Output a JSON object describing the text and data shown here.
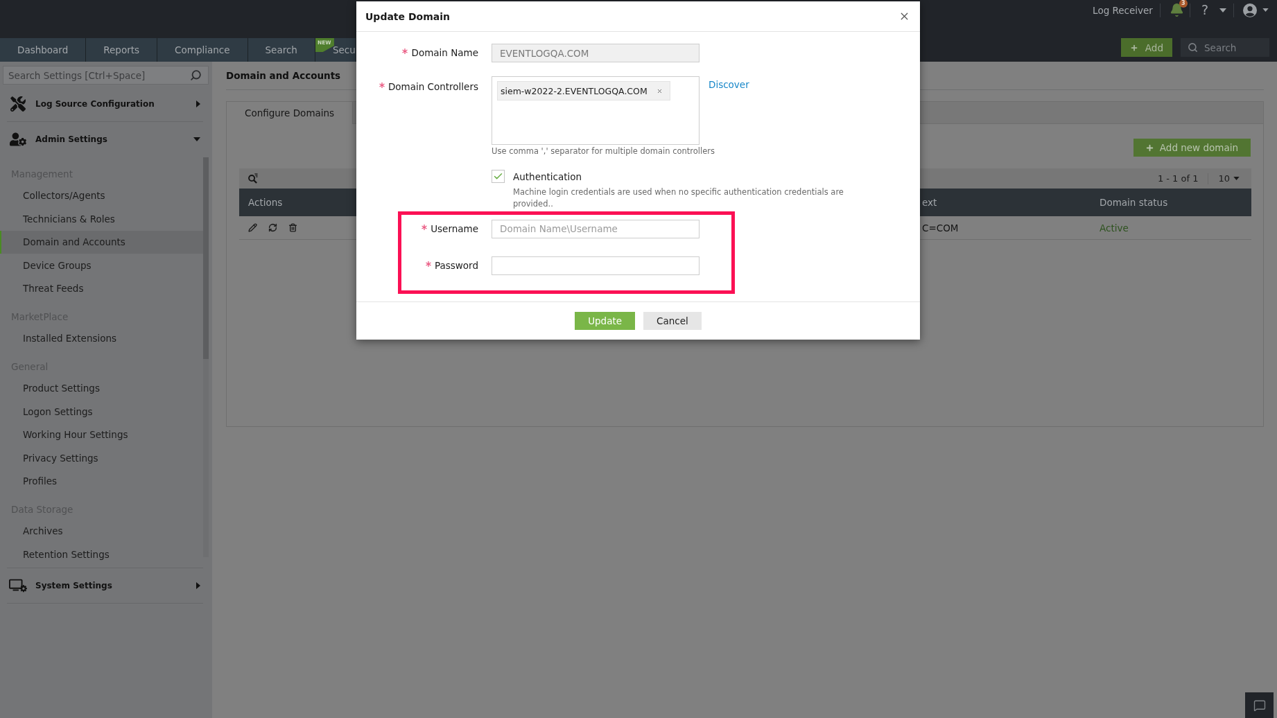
{
  "top_bar": {
    "nav_tabs": [
      {
        "label": "Dashboard",
        "selected": false
      },
      {
        "label": "Reports",
        "selected": false
      },
      {
        "label": "Compliance",
        "selected": false
      },
      {
        "label": "Search",
        "selected": false
      },
      {
        "label": "Secu",
        "selected": false,
        "badge": "NEW"
      }
    ],
    "instance_label": "Log Receiver",
    "notification_count": "3",
    "help_label": "?",
    "add_button": "Add",
    "search": {
      "placeholder": "Search"
    }
  },
  "sidebar": {
    "search": {
      "placeholder": "Search Settings [Ctrl+Space]"
    },
    "sections": [
      {
        "title": "Log Source Configuration",
        "expanded": false
      },
      {
        "title": "Admin Settings",
        "expanded": true,
        "groups": [
          {
            "title": "Management",
            "items": [
              {
                "label": "Collectors/Agents",
                "selected": false
              },
              {
                "label": "Technicians & Roles",
                "selected": false
              },
              {
                "label": "Domain and Accounts",
                "selected": true
              },
              {
                "label": "Device Groups",
                "selected": false
              },
              {
                "label": "Threat Feeds",
                "selected": false
              }
            ]
          },
          {
            "title": "MarketPlace",
            "items": [
              {
                "label": "Installed Extensions",
                "selected": false
              }
            ]
          },
          {
            "title": "General",
            "items": [
              {
                "label": "Product Settings",
                "selected": false
              },
              {
                "label": "Logon Settings",
                "selected": false
              },
              {
                "label": "Working Hour Settings",
                "selected": false
              },
              {
                "label": "Privacy Settings",
                "selected": false
              },
              {
                "label": "Profiles",
                "selected": false
              }
            ]
          },
          {
            "title": "Data Storage",
            "items": [
              {
                "label": "Archives",
                "selected": false
              },
              {
                "label": "Retention Settings",
                "selected": false
              }
            ]
          }
        ]
      },
      {
        "title": "System Settings",
        "expanded": false
      }
    ]
  },
  "page": {
    "title": "Domain and Accounts",
    "tabs": [
      {
        "label": "Configure Domains",
        "selected": true
      }
    ],
    "add_button": "Add new domain",
    "pagination": {
      "range": "1 - 1 of 1",
      "page_size": "10"
    },
    "table": {
      "columns": [
        {
          "label": "Actions",
          "kind": "actions"
        },
        {
          "label": "ext",
          "kind": "text"
        },
        {
          "label": "Domain status",
          "kind": "status"
        }
      ],
      "rows": [
        {
          "cells": [
            "",
            "C=COM",
            "Active"
          ]
        }
      ]
    }
  },
  "dialog": {
    "title": "Update Domain",
    "fields": [
      {
        "kind": "text",
        "label": "Domain Name",
        "required": true,
        "disabled": true,
        "highlighted": false,
        "value": "EVENTLOGQA.COM"
      },
      {
        "kind": "tags",
        "label": "Domain Controllers",
        "required": true,
        "disabled": false,
        "highlighted": false,
        "tags": [
          "siem-w2022-2.EVENTLOGQA.COM"
        ],
        "link": "Discover",
        "hint": "Use comma ',' separator for multiple domain controllers"
      },
      {
        "kind": "checkbox",
        "label": "Authentication",
        "checked": true,
        "highlighted": false,
        "description": "Machine login credentials are used when no specific authentication credentials are provided.."
      },
      {
        "kind": "text",
        "label": "Username",
        "required": true,
        "disabled": false,
        "highlighted": true,
        "placeholder": "Domain Name\\Username"
      },
      {
        "kind": "password",
        "label": "Password",
        "required": true,
        "disabled": false,
        "highlighted": true
      }
    ],
    "buttons": [
      {
        "label": "Update",
        "kind": "primary"
      },
      {
        "label": "Cancel",
        "kind": "secondary"
      }
    ]
  }
}
